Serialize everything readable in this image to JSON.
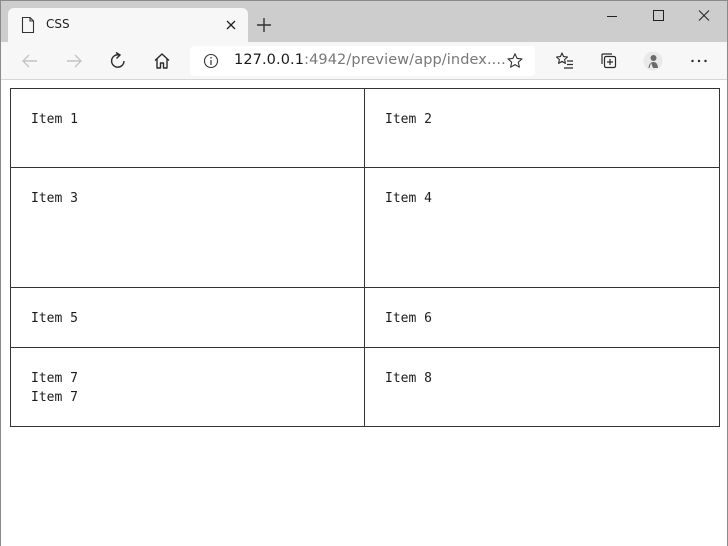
{
  "tab": {
    "title": "CSS"
  },
  "address": {
    "host": "127.0.0.1",
    "rest": ":4942/preview/app/index...."
  },
  "icons": {
    "tab": "page-icon",
    "back": "back-arrow-icon",
    "forward": "forward-arrow-icon",
    "refresh": "refresh-icon",
    "home": "home-icon",
    "info": "info-icon",
    "favorite": "star-icon",
    "favorites": "favorites-list-icon",
    "collections": "collections-icon",
    "profile": "profile-avatar-icon",
    "more": "more-icon"
  },
  "grid": {
    "items": [
      "Item 1",
      "Item 2",
      "Item 3",
      "Item 4",
      "Item 5",
      "Item 6",
      "Item 7\nItem 7",
      "Item 8"
    ]
  }
}
